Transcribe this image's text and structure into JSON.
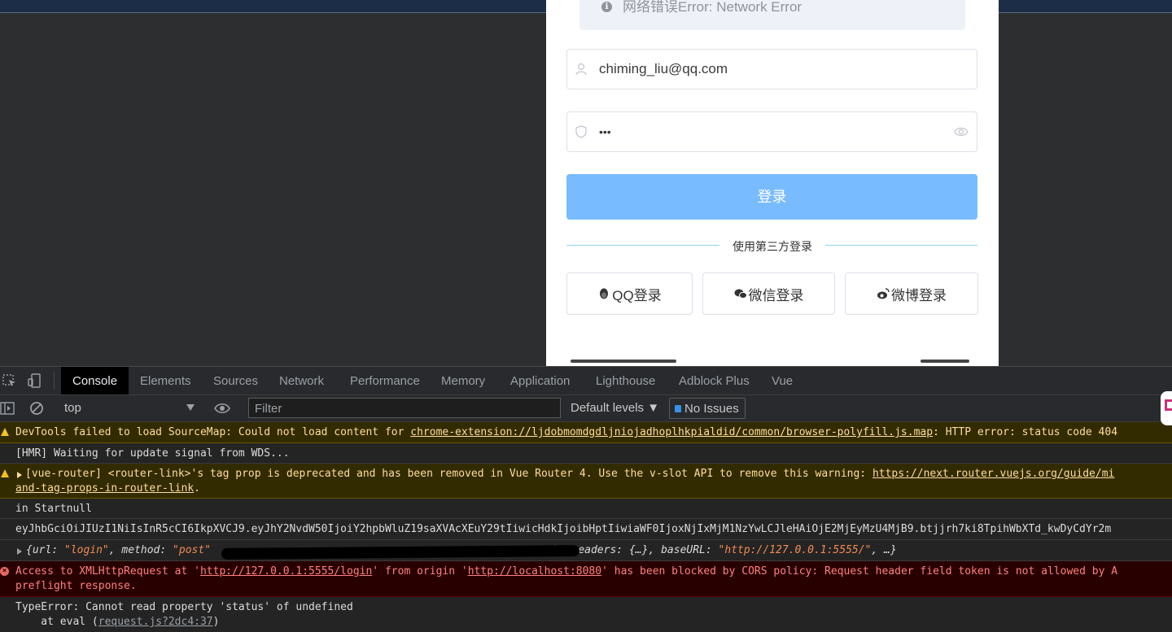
{
  "page": {
    "alert_text": "网络错误Error: Network Error",
    "email_value": "chiming_liu@qq.com",
    "password_masked": "•••",
    "login_button": "登录",
    "divider_text": "使用第三方登录",
    "third_party": [
      {
        "label": "QQ登录",
        "icon": "qq-penguin-icon"
      },
      {
        "label": "微信登录",
        "icon": "wechat-icon"
      },
      {
        "label": "微博登录",
        "icon": "weibo-icon"
      }
    ],
    "colors": {
      "primary_light": "#79bbff",
      "divider": "#8fd3ef"
    }
  },
  "devtools": {
    "tabs": [
      "Console",
      "Elements",
      "Sources",
      "Network",
      "Performance",
      "Memory",
      "Application",
      "Lighthouse",
      "Adblock Plus",
      "Vue"
    ],
    "active_tab": "Console",
    "context": "top",
    "filter_placeholder": "Filter",
    "levels": "Default levels ▼",
    "issues": "No Issues",
    "messages": {
      "m1_text": "DevTools failed to load SourceMap: Could not load content for ",
      "m1_link": "chrome-extension://ljdobmomdgdljniojadhoplhkpialdid/common/browser-polyfill.js.map",
      "m1_tail": ": HTTP error: status code 404",
      "m2": "[HMR] Waiting for update signal from WDS...",
      "m3_text": "[vue-router] <router-link>'s tag prop is deprecated and has been removed in Vue Router 4. Use the v-slot API to remove this warning: ",
      "m3_link": "https://next.router.vuejs.org/guide/mi",
      "m3_link2": "and-tag-props-in-router-link",
      "m3_tail": ".",
      "m4": "in Startnull",
      "m5": "eyJhbGciOiJIUzI1NiIsInR5cCI6IkpXVCJ9.eyJhY2NvdW50IjoiY2hpbWluZ19saXVAcXEuY29tIiwicHdkIjoibHptIiwiaWF0IjoxNjIxMjM1NzYwLCJleHAiOjE2MjEyMzU4MjB9.btjjrh7ki8TpihWbXTd_kwDyCdYr2m",
      "m6_open": "{",
      "m6_k1": "url",
      "m6_v1": "\"login\"",
      "m6_k2": "method",
      "m6_v2": "\"post\"",
      "m6_mid": "}",
      "m6_k3": "headers",
      "m6_v3": "{…}",
      "m6_k4": "baseURL",
      "m6_v4": "\"http://127.0.0.1:5555/\"",
      "m6_end": ", …}",
      "m7_a": "Access to XMLHttpRequest at '",
      "m7_link1": "http://127.0.0.1:5555/login",
      "m7_b": "' from origin '",
      "m7_link2": "http://localhost:8080",
      "m7_c": "' has been blocked by CORS policy: Request header field token is not allowed by A",
      "m7_line2": "preflight response.",
      "m8_line1": "TypeError: Cannot read property 'status' of undefined",
      "m8_line2": "    at eval (",
      "m8_link": "request.js?2dc4:37",
      "m8_tail": ")"
    }
  }
}
